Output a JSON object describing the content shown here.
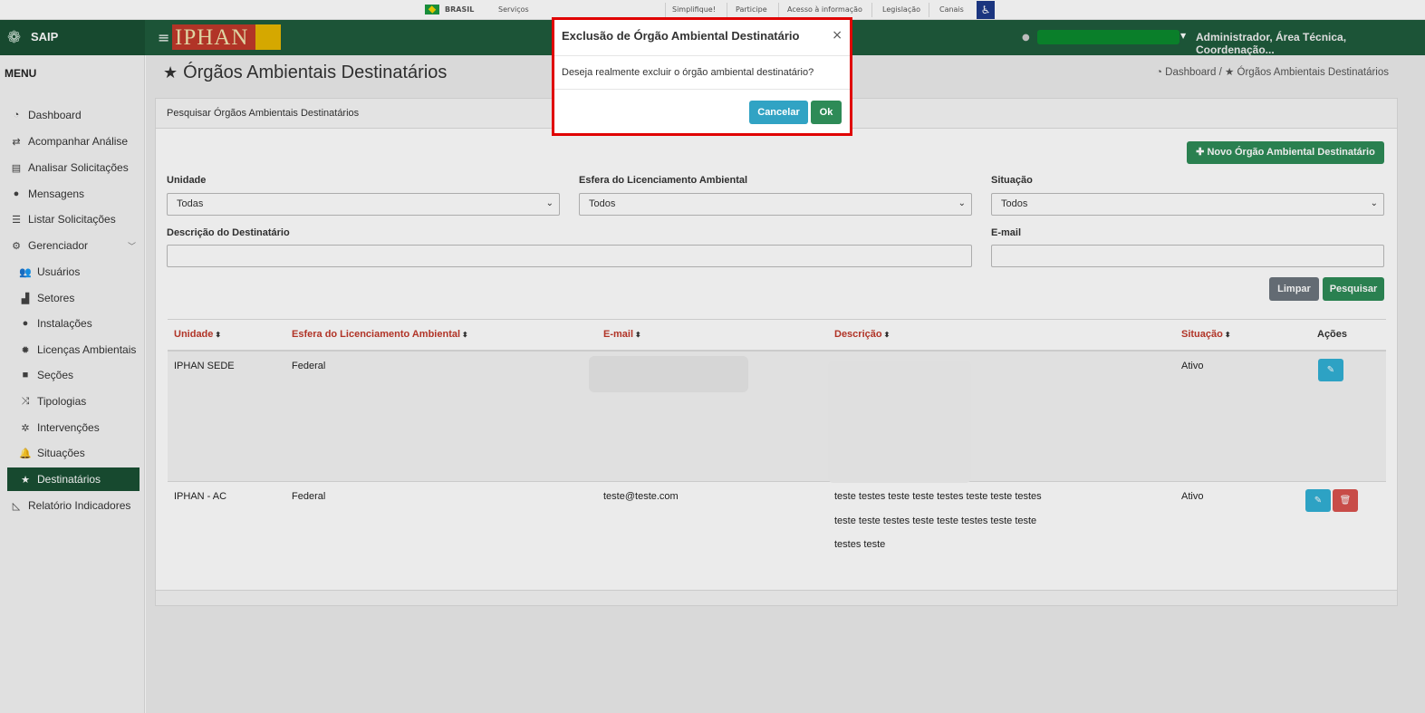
{
  "govbar": {
    "country": "BRASIL",
    "services": "Serviços",
    "links": [
      "Simplifique!",
      "Participe",
      "Acesso à informação",
      "Legislação",
      "Canais"
    ]
  },
  "header": {
    "brand": "SAIP",
    "logo_text": "IPHAN",
    "user_role": "Administrador, Área Técnica, Coordenação..."
  },
  "sidebar": {
    "title": "MENU",
    "items": [
      {
        "label": "Dashboard",
        "icon": "dashboard-icon"
      },
      {
        "label": "Acompanhar Análise",
        "icon": "exchange-icon"
      },
      {
        "label": "Analisar Solicitações",
        "icon": "book-icon"
      },
      {
        "label": "Mensagens",
        "icon": "chat-icon"
      },
      {
        "label": "Listar Solicitações",
        "icon": "list-icon"
      },
      {
        "label": "Gerenciador",
        "icon": "gears-icon"
      },
      {
        "label": "Usuários",
        "icon": "users-icon"
      },
      {
        "label": "Setores",
        "icon": "industry-icon"
      },
      {
        "label": "Instalações",
        "icon": "circle-icon"
      },
      {
        "label": "Licenças Ambientais",
        "icon": "certificate-icon"
      },
      {
        "label": "Seções",
        "icon": "square-icon"
      },
      {
        "label": "Tipologias",
        "icon": "random-icon"
      },
      {
        "label": "Intervenções",
        "icon": "spinner-icon"
      },
      {
        "label": "Situações",
        "icon": "bell-icon"
      },
      {
        "label": "Destinatários",
        "icon": "star-icon"
      },
      {
        "label": "Relatório Indicadores",
        "icon": "area-chart-icon"
      }
    ]
  },
  "page": {
    "title": "Órgãos Ambientais Destinatários",
    "breadcrumb_home": "Dashboard",
    "breadcrumb_sep": "/",
    "breadcrumb_current": "Órgãos Ambientais Destinatários"
  },
  "panel": {
    "heading": "Pesquisar Órgãos Ambientais Destinatários",
    "new_button": "Novo Órgão Ambiental Destinatário",
    "filters": {
      "unidade_label": "Unidade",
      "unidade_value": "Todas",
      "esfera_label": "Esfera do Licenciamento Ambiental",
      "esfera_value": "Todos",
      "situacao_label": "Situação",
      "situacao_value": "Todos",
      "descricao_label": "Descrição do Destinatário",
      "descricao_value": "",
      "email_label": "E-mail",
      "email_value": ""
    },
    "clear_button": "Limpar",
    "search_button": "Pesquisar"
  },
  "table": {
    "headers": [
      "Unidade",
      "Esfera do Licenciamento Ambiental",
      "E-mail",
      "Descrição",
      "Situação",
      "Ações"
    ],
    "rows": [
      {
        "unidade": "IPHAN SEDE",
        "esfera": "Federal",
        "email": "",
        "descricao": "",
        "situacao": "Ativo"
      },
      {
        "unidade": "IPHAN - AC",
        "esfera": "Federal",
        "email": "teste@teste.com",
        "descricao": "teste testes teste teste testes teste teste testes teste teste testes teste teste testes teste teste testes teste",
        "situacao": "Ativo"
      }
    ]
  },
  "modal": {
    "title": "Exclusão de Órgão Ambiental Destinatário",
    "close": "×",
    "message": "Deseja realmente excluir o órgão ambiental destinatário?",
    "cancel": "Cancelar",
    "ok": "Ok"
  },
  "colors": {
    "header_green": "#1f5c3c",
    "active_green": "#1a5034",
    "button_green": "#2e8b57",
    "sort_red": "#c0392b",
    "modal_border": "#e00000"
  }
}
